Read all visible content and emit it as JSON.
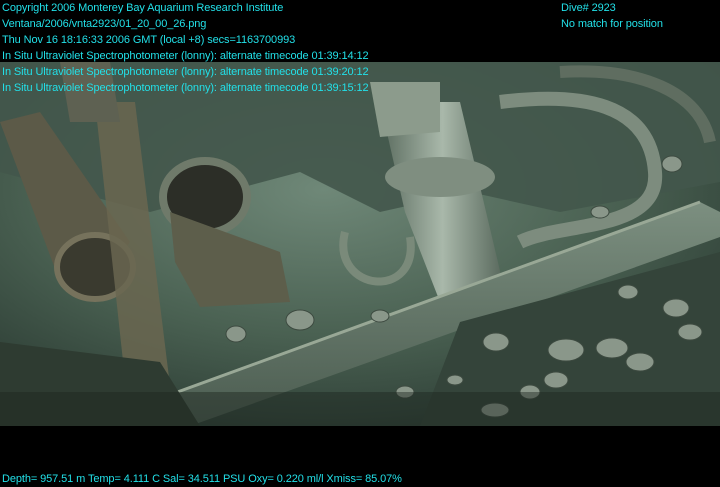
{
  "overlay": {
    "header_left": [
      "Copyright 2006 Monterey Bay Aquarium Research Institute",
      "Ventana/2006/vnta2923/01_20_00_26.png",
      "Thu Nov 16 18:16:33 2006 GMT (local +8)  secs=1163700993",
      "In Situ Ultraviolet Spectrophotometer (lonny): alternate timecode 01:39:14:12",
      "In Situ Ultraviolet Spectrophotometer (lonny): alternate timecode 01:39:20:12",
      "In Situ Ultraviolet Spectrophotometer (lonny): alternate timecode 01:39:15:12"
    ],
    "header_right": [
      "Dive# 2923",
      "No match for position"
    ],
    "footer": "Depth= 957.51 m  Temp= 4.111 C  Sal= 34.511 PSU  Oxy= 0.220 ml/l  Xmiss= 85.07%"
  },
  "colors": {
    "overlay_text": "#22e0e8",
    "water": "#3f5a4c",
    "seafloor": "#2a3a30"
  }
}
